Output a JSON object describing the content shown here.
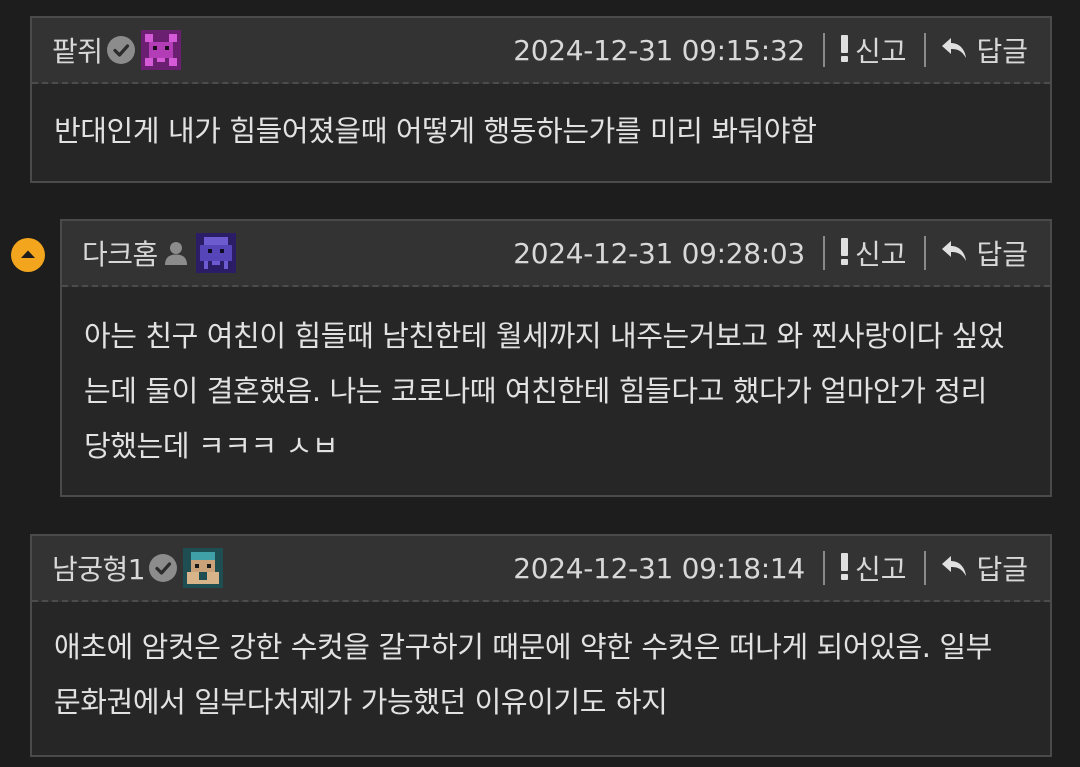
{
  "comments": [
    {
      "author": "팥쥐",
      "timestamp": "2024-12-31 09:15:32",
      "report_label": "신고",
      "reply_label": "답글",
      "body": "반대인게 내가 힘들어졌을때 어떻게 행동하는가를 미리 봐둬야함",
      "badge_icon": "verified-icon",
      "avatar_color": "#8a2f8d"
    },
    {
      "author": "다크홈",
      "timestamp": "2024-12-31 09:28:03",
      "report_label": "신고",
      "reply_label": "답글",
      "body": "아는 친구 여친이 힘들때 남친한테 월세까지 내주는거보고 와 찐사랑이다 싶었는데 둘이 결혼했음. 나는 코로나때 여친한테 힘들다고 했다가 얼마안가 정리당했는데 ㅋㅋㅋ ㅅㅂ",
      "badge_icon": "user-icon",
      "avatar_color": "#3c2b86"
    },
    {
      "author": "남궁형1",
      "timestamp": "2024-12-31 09:18:14",
      "report_label": "신고",
      "reply_label": "답글",
      "body": "애초에 암컷은 강한 수컷을 갈구하기 때문에 약한 수컷은 떠나게 되어있음. 일부 문화권에서 일부다처제가 가능했던 이유이기도 하지",
      "badge_icon": "verified-icon",
      "avatar_color": "#2e6f73"
    }
  ],
  "colors": {
    "background": "#1d1d1d",
    "header": "#333333",
    "body": "#262626",
    "accent": "#f2a51d"
  }
}
